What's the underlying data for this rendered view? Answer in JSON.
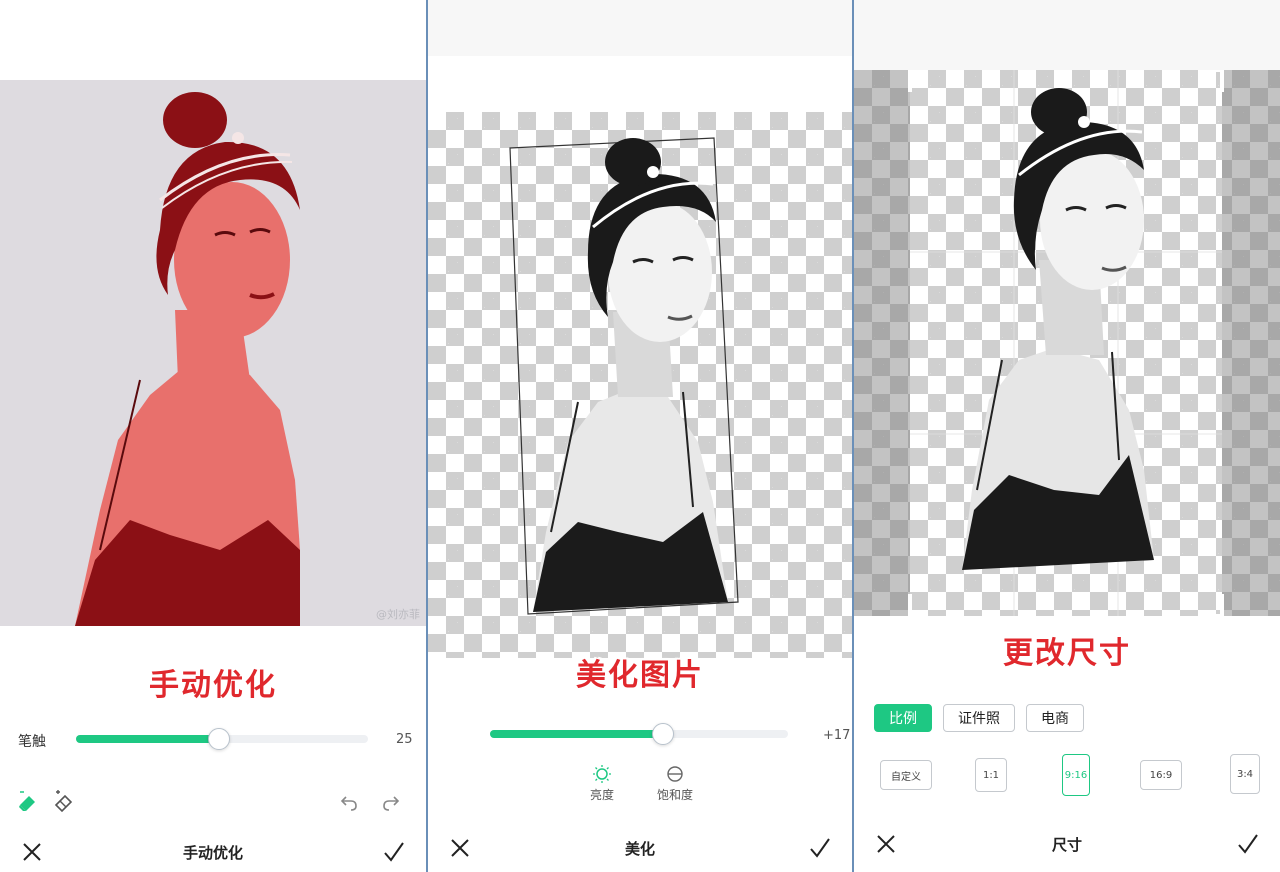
{
  "panel1": {
    "caption": "手动优化",
    "brush_label": "笔触",
    "brush_value": "25",
    "brush_level": 0.49,
    "title": "手动优化",
    "watermark": "@刘亦菲"
  },
  "panel2": {
    "caption": "美化图片",
    "slider_value": "+17",
    "slider_level": 0.58,
    "tool_brightness": "亮度",
    "tool_saturation": "饱和度",
    "title": "美化"
  },
  "panel3": {
    "caption": "更改尺寸",
    "tabs": [
      "比例",
      "证件照",
      "电商"
    ],
    "ratios": [
      "自定义",
      "1:1",
      "9:16",
      "16:9",
      "3:4"
    ],
    "title": "尺寸"
  },
  "colors": {
    "accent": "#1ec883",
    "caption_red": "#e0282d",
    "mask_red": "#e8706c"
  },
  "icons": {
    "close": "close-icon",
    "confirm": "check-icon",
    "brush": "eraser-fill-icon",
    "eraser": "eraser-outline-icon",
    "undo": "undo-icon",
    "redo": "redo-icon",
    "brightness": "sun-icon",
    "saturation": "saturation-icon"
  }
}
